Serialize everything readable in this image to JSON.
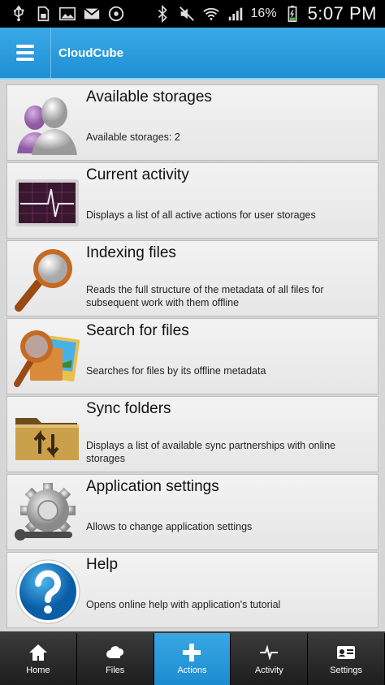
{
  "status_bar": {
    "battery_percent": "16%",
    "time": "5:07 PM",
    "icons_left": [
      "usb-icon",
      "sd-card-icon",
      "gallery-icon",
      "gmail-icon",
      "sync-icon"
    ],
    "icons_right": [
      "bluetooth-icon",
      "mute-icon",
      "wifi-icon",
      "signal-icon",
      "battery-icon"
    ]
  },
  "app_bar": {
    "title": "CloudCube",
    "menu_icon": "hamburger-menu-icon"
  },
  "items": [
    {
      "title": "Available storages",
      "desc": "Available storages: 2",
      "icon": "users-icon"
    },
    {
      "title": "Current activity",
      "desc": "Displays a list of all active actions for user storages",
      "icon": "activity-monitor-icon"
    },
    {
      "title": "Indexing files",
      "desc": "Reads the full structure of the metadata of all files for subsequent work with them offline",
      "icon": "magnifier-icon"
    },
    {
      "title": "Search for files",
      "desc": "Searches for files by its offline metadata",
      "icon": "search-photos-icon"
    },
    {
      "title": "Sync folders",
      "desc": "Displays a list of available sync partnerships with online storages",
      "icon": "sync-folder-icon"
    },
    {
      "title": "Application settings",
      "desc": "Allows to change application settings",
      "icon": "gear-wrench-icon"
    },
    {
      "title": "Help",
      "desc": "Opens online help with application's tutorial",
      "icon": "help-icon"
    }
  ],
  "bottom_nav": [
    {
      "label": "Home",
      "icon": "home-icon",
      "active": false
    },
    {
      "label": "Files",
      "icon": "cloud-files-icon",
      "active": false
    },
    {
      "label": "Actions",
      "icon": "plus-icon",
      "active": true
    },
    {
      "label": "Activity",
      "icon": "pulse-icon",
      "active": false
    },
    {
      "label": "Settings",
      "icon": "id-card-icon",
      "active": false
    }
  ],
  "colors": {
    "accent": "#2a9de0",
    "active_tab": "#2a9de0",
    "background": "#d6d6d6"
  }
}
